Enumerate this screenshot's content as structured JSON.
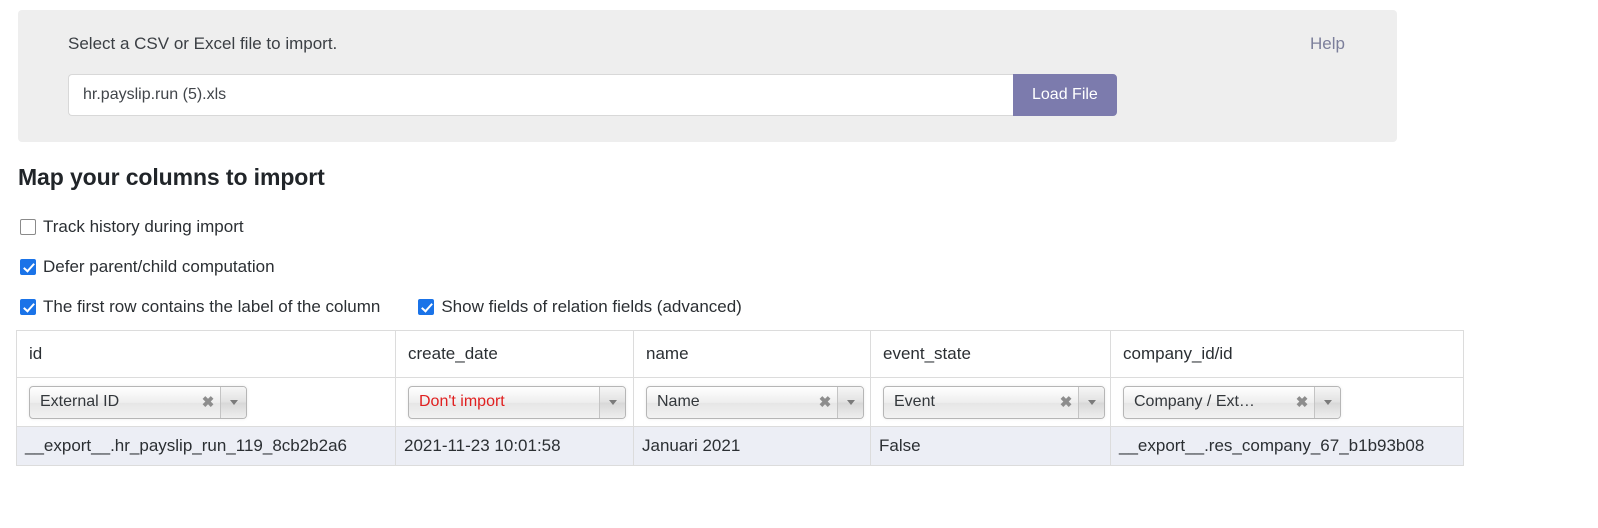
{
  "upload": {
    "label": "Select a CSV or Excel file to import.",
    "help_label": "Help",
    "file_value": "hr.payslip.run (5).xls",
    "file_placeholder": "",
    "load_button_label": "Load File",
    "button_color": "#7c7bad",
    "panel_color": "#eeeeee"
  },
  "section": {
    "title": "Map your columns to import"
  },
  "options": [
    {
      "label": "Track history during import",
      "checked": false
    },
    {
      "label": "Defer parent/child computation",
      "checked": true
    },
    {
      "label": "The first row contains the label of the column",
      "checked": true
    },
    {
      "label": "Show fields of relation fields (advanced)",
      "checked": true
    }
  ],
  "checkbox_color": "#1a73e8",
  "table": {
    "headers": [
      "id",
      "create_date",
      "name",
      "event_state",
      "company_id/id"
    ],
    "mappings": [
      {
        "value": "External ID",
        "clearable": true,
        "dont_import": false
      },
      {
        "value": "Don't import",
        "clearable": false,
        "dont_import": true
      },
      {
        "value": "Name",
        "clearable": true,
        "dont_import": false
      },
      {
        "value": "Event",
        "clearable": true,
        "dont_import": false
      },
      {
        "value": "Company / Ext…",
        "clearable": true,
        "dont_import": false
      }
    ],
    "clear_glyph": "✖",
    "rows": [
      [
        "__export__.hr_payslip_run_119_8cb2b2a6",
        "2021-11-23 10:01:58",
        "Januari 2021",
        "False",
        "__export__.res_company_67_b1b93b08"
      ]
    ]
  }
}
